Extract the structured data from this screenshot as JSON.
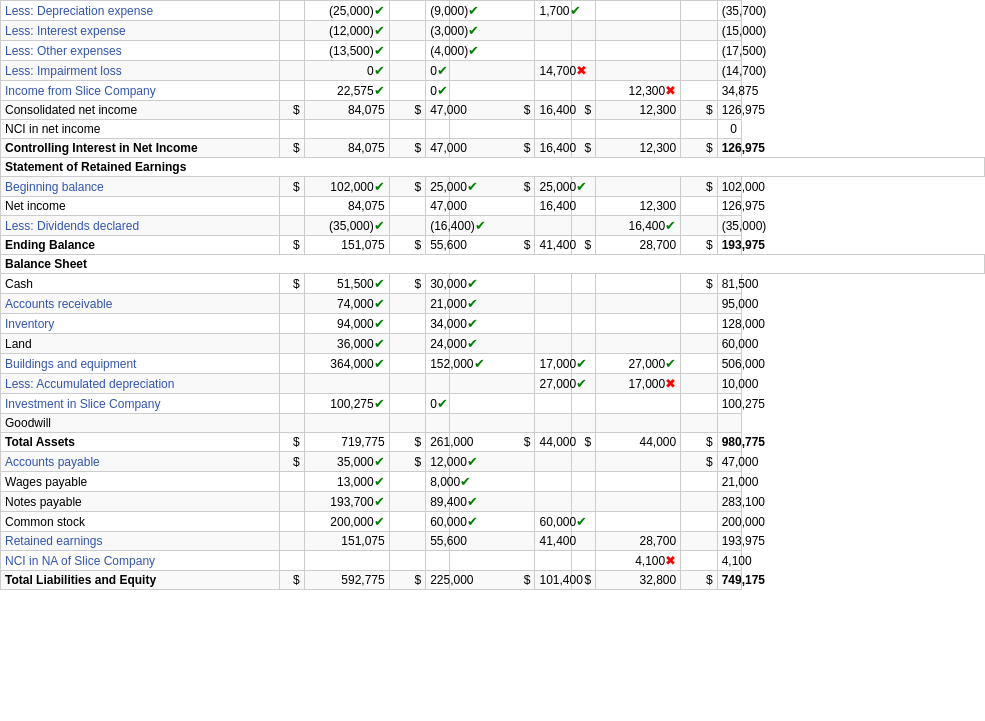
{
  "rows": [
    {
      "label": "Less: Depreciation expense",
      "labelColor": "blue",
      "bold": false,
      "p": "(25,000)",
      "pCheck": "green",
      "s": "(9,000)",
      "sCheck": "green",
      "dr": "1,700",
      "drCheck": "green",
      "cr": "",
      "crCheck": "",
      "total": "(35,700)",
      "totalSign": ""
    },
    {
      "label": "Less: Interest expense",
      "labelColor": "blue",
      "bold": false,
      "p": "(12,000)",
      "pCheck": "green",
      "s": "(3,000)",
      "sCheck": "green",
      "dr": "",
      "drCheck": "",
      "cr": "",
      "crCheck": "",
      "total": "(15,000)",
      "totalSign": ""
    },
    {
      "label": "Less: Other expenses",
      "labelColor": "blue",
      "bold": false,
      "p": "(13,500)",
      "pCheck": "green",
      "s": "(4,000)",
      "sCheck": "green",
      "dr": "",
      "drCheck": "",
      "cr": "",
      "crCheck": "",
      "total": "(17,500)",
      "totalSign": ""
    },
    {
      "label": "Less: Impairment loss",
      "labelColor": "blue",
      "bold": false,
      "p": "0",
      "pCheck": "green",
      "s": "0",
      "sCheck": "green",
      "dr": "14,700",
      "drCheck": "red",
      "cr": "",
      "crCheck": "",
      "total": "(14,700)",
      "totalSign": ""
    },
    {
      "label": "Income from Slice Company",
      "labelColor": "blue",
      "bold": false,
      "p": "22,575",
      "pCheck": "green",
      "s": "0",
      "sCheck": "green",
      "dr": "",
      "drCheck": "",
      "cr": "12,300",
      "crCheck": "red",
      "total": "34,875",
      "totalSign": ""
    },
    {
      "label": "Consolidated net income",
      "labelColor": "",
      "bold": false,
      "pSign": "$",
      "p": "84,075",
      "pCheck": "",
      "sSign": "$",
      "s": "47,000",
      "sCheck": "",
      "drSign": "$",
      "dr": "16,400",
      "drCheck": "",
      "crSign": "$",
      "cr": "12,300",
      "crCheck": "",
      "totalSign": "$",
      "total": "126,975",
      "totalCheck": ""
    },
    {
      "label": "NCI in net income",
      "labelColor": "",
      "bold": false,
      "p": "",
      "pCheck": "",
      "s": "",
      "sCheck": "",
      "dr": "",
      "drCheck": "",
      "cr": "",
      "crCheck": "",
      "total": "0",
      "totalSign": ""
    },
    {
      "label": "Controlling Interest in Net Income",
      "labelColor": "",
      "bold": true,
      "pSign": "$",
      "p": "84,075",
      "pCheck": "",
      "sSign": "$",
      "s": "47,000",
      "sCheck": "",
      "drSign": "$",
      "dr": "16,400",
      "drCheck": "",
      "crSign": "$",
      "cr": "12,300",
      "crCheck": "",
      "totalSign": "$",
      "total": "126,975",
      "totalCheck": ""
    },
    {
      "sectionHeader": "Statement of Retained Earnings"
    },
    {
      "label": "Beginning balance",
      "labelColor": "blue",
      "bold": false,
      "pSign": "$",
      "p": "102,000",
      "pCheck": "green",
      "sSign": "$",
      "s": "25,000",
      "sCheck": "green",
      "drSign": "$",
      "dr": "25,000",
      "drCheck": "green",
      "cr": "",
      "crCheck": "",
      "totalSign": "$",
      "total": "102,000",
      "totalCheck": ""
    },
    {
      "label": "Net income",
      "labelColor": "",
      "bold": false,
      "p": "84,075",
      "pCheck": "",
      "s": "47,000",
      "sCheck": "",
      "dr": "16,400",
      "drCheck": "",
      "cr": "12,300",
      "crCheck": "",
      "total": "126,975",
      "totalSign": ""
    },
    {
      "label": "Less: Dividends declared",
      "labelColor": "blue",
      "bold": false,
      "p": "(35,000)",
      "pCheck": "green",
      "s": "(16,400)",
      "sCheck": "green",
      "dr": "",
      "drCheck": "",
      "cr": "16,400",
      "crCheck": "green",
      "total": "(35,000)",
      "totalSign": ""
    },
    {
      "label": "Ending Balance",
      "labelColor": "",
      "bold": true,
      "pSign": "$",
      "p": "151,075",
      "pCheck": "",
      "sSign": "$",
      "s": "55,600",
      "sCheck": "",
      "drSign": "$",
      "dr": "41,400",
      "drCheck": "",
      "crSign": "$",
      "cr": "28,700",
      "crCheck": "",
      "totalSign": "$",
      "total": "193,975",
      "totalCheck": ""
    },
    {
      "sectionHeader": "Balance Sheet"
    },
    {
      "label": "Cash",
      "labelColor": "",
      "bold": false,
      "pSign": "$",
      "p": "51,500",
      "pCheck": "green",
      "sSign": "$",
      "s": "30,000",
      "sCheck": "green",
      "dr": "",
      "drCheck": "",
      "cr": "",
      "crCheck": "",
      "totalSign": "$",
      "total": "81,500",
      "totalCheck": ""
    },
    {
      "label": "Accounts receivable",
      "labelColor": "blue",
      "bold": false,
      "p": "74,000",
      "pCheck": "green",
      "s": "21,000",
      "sCheck": "green",
      "dr": "",
      "drCheck": "",
      "cr": "",
      "crCheck": "",
      "total": "95,000",
      "totalSign": ""
    },
    {
      "label": "Inventory",
      "labelColor": "blue",
      "bold": false,
      "p": "94,000",
      "pCheck": "green",
      "s": "34,000",
      "sCheck": "green",
      "dr": "",
      "drCheck": "",
      "cr": "",
      "crCheck": "",
      "total": "128,000",
      "totalSign": ""
    },
    {
      "label": "Land",
      "labelColor": "",
      "bold": false,
      "p": "36,000",
      "pCheck": "green",
      "s": "24,000",
      "sCheck": "green",
      "dr": "",
      "drCheck": "",
      "cr": "",
      "crCheck": "",
      "total": "60,000",
      "totalSign": ""
    },
    {
      "label": "Buildings and equipment",
      "labelColor": "blue",
      "bold": false,
      "p": "364,000",
      "pCheck": "green",
      "s": "152,000",
      "sCheck": "green",
      "dr": "17,000",
      "drCheck": "green",
      "cr": "27,000",
      "crCheck": "green",
      "total": "506,000",
      "totalSign": ""
    },
    {
      "label": "Less: Accumulated depreciation",
      "labelColor": "blue",
      "bold": false,
      "p": "",
      "pCheck": "",
      "s": "",
      "sCheck": "",
      "dr": "27,000",
      "drCheck": "green",
      "cr": "17,000",
      "crCheck": "red",
      "total": "10,000",
      "totalSign": ""
    },
    {
      "label": "Investment in Slice Company",
      "labelColor": "blue",
      "bold": false,
      "p": "100,275",
      "pCheck": "green",
      "s": "0",
      "sCheck": "green",
      "dr": "",
      "drCheck": "",
      "cr": "",
      "crCheck": "",
      "total": "100,275",
      "totalSign": ""
    },
    {
      "label": "Goodwill",
      "labelColor": "",
      "bold": false,
      "p": "",
      "pCheck": "",
      "s": "",
      "sCheck": "",
      "dr": "",
      "drCheck": "",
      "cr": "",
      "crCheck": "",
      "total": "",
      "totalSign": ""
    },
    {
      "label": "Total Assets",
      "labelColor": "",
      "bold": true,
      "pSign": "$",
      "p": "719,775",
      "pCheck": "",
      "sSign": "$",
      "s": "261,000",
      "sCheck": "",
      "drSign": "$",
      "dr": "44,000",
      "drCheck": "",
      "crSign": "$",
      "cr": "44,000",
      "crCheck": "",
      "totalSign": "$",
      "total": "980,775",
      "totalCheck": ""
    },
    {
      "label": "Accounts payable",
      "labelColor": "blue",
      "bold": false,
      "pSign": "$",
      "p": "35,000",
      "pCheck": "green",
      "sSign": "$",
      "s": "12,000",
      "sCheck": "green",
      "dr": "",
      "drCheck": "",
      "cr": "",
      "crCheck": "",
      "totalSign": "$",
      "total": "47,000",
      "totalCheck": ""
    },
    {
      "label": "Wages payable",
      "labelColor": "",
      "bold": false,
      "p": "13,000",
      "pCheck": "green",
      "s": "8,000",
      "sCheck": "green",
      "dr": "",
      "drCheck": "",
      "cr": "",
      "crCheck": "",
      "total": "21,000",
      "totalSign": ""
    },
    {
      "label": "Notes payable",
      "labelColor": "",
      "bold": false,
      "p": "193,700",
      "pCheck": "green",
      "s": "89,400",
      "sCheck": "green",
      "dr": "",
      "drCheck": "",
      "cr": "",
      "crCheck": "",
      "total": "283,100",
      "totalSign": ""
    },
    {
      "label": "Common stock",
      "labelColor": "",
      "bold": false,
      "p": "200,000",
      "pCheck": "green",
      "s": "60,000",
      "sCheck": "green",
      "dr": "60,000",
      "drCheck": "green",
      "cr": "",
      "crCheck": "",
      "total": "200,000",
      "totalSign": ""
    },
    {
      "label": "Retained earnings",
      "labelColor": "blue",
      "bold": false,
      "p": "151,075",
      "pCheck": "",
      "s": "55,600",
      "sCheck": "",
      "dr": "41,400",
      "drCheck": "",
      "cr": "28,700",
      "crCheck": "",
      "total": "193,975",
      "totalSign": ""
    },
    {
      "label": "NCI in NA of Slice Company",
      "labelColor": "blue",
      "bold": false,
      "p": "",
      "pCheck": "",
      "s": "",
      "sCheck": "",
      "dr": "",
      "drCheck": "",
      "cr": "4,100",
      "crCheck": "red",
      "total": "4,100",
      "totalSign": ""
    },
    {
      "label": "Total Liabilities and Equity",
      "labelColor": "",
      "bold": true,
      "pSign": "$",
      "p": "592,775",
      "pCheck": "",
      "sSign": "$",
      "s": "225,000",
      "sCheck": "",
      "drSign": "$",
      "dr": "101,400",
      "drCheck": "",
      "crSign": "$",
      "cr": "32,800",
      "crCheck": "",
      "totalSign": "$",
      "total": "749,175",
      "totalCheck": ""
    }
  ],
  "icons": {
    "check_green": "✔",
    "check_red": "✖"
  }
}
